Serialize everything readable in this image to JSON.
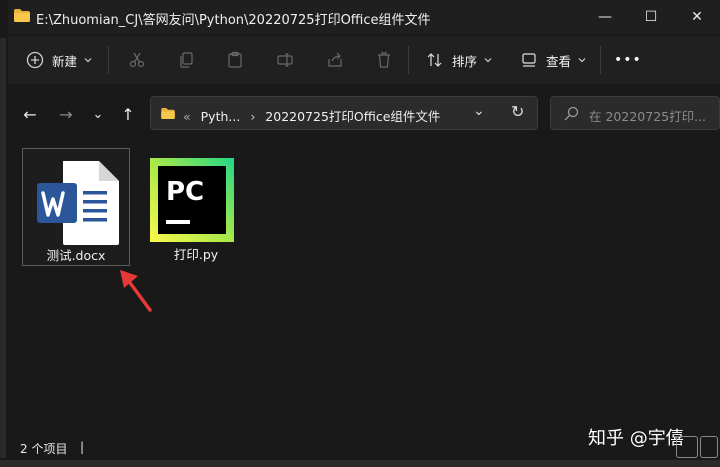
{
  "window": {
    "title": "E:\\Zhuomian_CJ\\答网友问\\Python\\20220725打印Office组件文件",
    "minimize_glyph": "—",
    "maximize_glyph": "☐",
    "close_glyph": "✕"
  },
  "toolbar": {
    "new_label": "新建",
    "sort_label": "排序",
    "view_label": "查看",
    "more_label": "•••"
  },
  "nav": {
    "back_glyph": "←",
    "forward_glyph": "→",
    "recent_glyph": "⌄",
    "up_glyph": "↑",
    "address_chevron": "«",
    "address_parent": "Pyth...",
    "address_sep": "›",
    "address_current": "20220725打印Office组件文件",
    "address_dropdown": "⌄",
    "refresh_glyph": "↻",
    "search_placeholder": "在 20220725打印..."
  },
  "files": [
    {
      "name": "测试.docx",
      "icon": "word-document-icon",
      "selected": true
    },
    {
      "name": "打印.py",
      "icon": "pycharm-icon",
      "selected": false
    }
  ],
  "status": {
    "count": "2 个项目",
    "separator": "|"
  },
  "watermark": "知乎 @宇僖",
  "colors": {
    "accent_red": "#e53935",
    "word_blue": "#2b579a",
    "pycharm_green": "#21d789",
    "pycharm_yellow": "#fcf84a"
  }
}
